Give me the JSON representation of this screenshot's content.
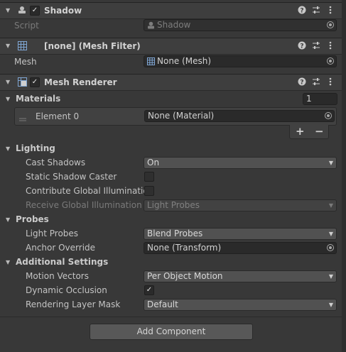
{
  "shadow": {
    "title": "Shadow",
    "script_label": "Script",
    "script_value": "Shadow"
  },
  "mesh_filter": {
    "title": "[none] (Mesh Filter)",
    "mesh_label": "Mesh",
    "mesh_value": "None (Mesh)"
  },
  "mesh_renderer": {
    "title": "Mesh Renderer",
    "materials_label": "Materials",
    "materials_count": "1",
    "element0_label": "Element 0",
    "element0_value": "None (Material)",
    "add_label": "+",
    "remove_label": "−",
    "lighting": {
      "label": "Lighting",
      "cast_shadows_label": "Cast Shadows",
      "cast_shadows_value": "On",
      "static_caster_label": "Static Shadow Caster",
      "contribute_gi_label": "Contribute Global Illumination",
      "receive_gi_label": "Receive Global Illumination",
      "receive_gi_value": "Light Probes"
    },
    "probes": {
      "label": "Probes",
      "light_probes_label": "Light Probes",
      "light_probes_value": "Blend Probes",
      "anchor_label": "Anchor Override",
      "anchor_value": "None (Transform)"
    },
    "additional": {
      "label": "Additional Settings",
      "motion_vectors_label": "Motion Vectors",
      "motion_vectors_value": "Per Object Motion",
      "dynamic_occlusion_label": "Dynamic Occlusion",
      "rendering_layer_label": "Rendering Layer Mask",
      "rendering_layer_value": "Default"
    }
  },
  "add_component_label": "Add Component",
  "checkmark": "✓"
}
